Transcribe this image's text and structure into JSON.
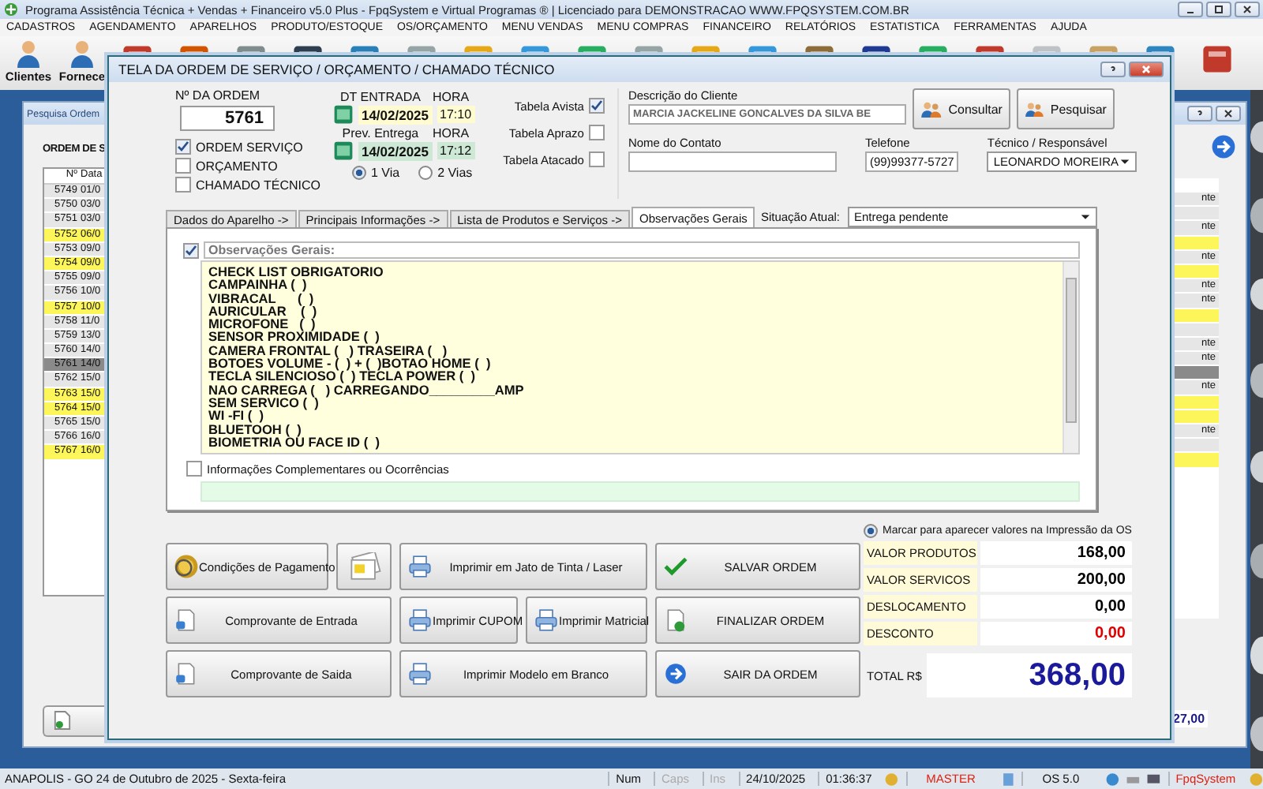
{
  "app": {
    "title": "Programa Assistência Técnica + Vendas + Financeiro v5.0 Plus - FpqSystem e Virtual Programas ® | Licenciado para  DEMONSTRACAO WWW.FPQSYSTEM.COM.BR"
  },
  "menu": [
    "CADASTROS",
    "AGENDAMENTO",
    "APARELHOS",
    "PRODUTO/ESTOQUE",
    "OS/ORÇAMENTO",
    "MENU VENDAS",
    "MENU COMPRAS",
    "FINANCEIRO",
    "RELATÓRIOS",
    "ESTATISTICA",
    "FERRAMENTAS",
    "AJUDA"
  ],
  "toolbar": {
    "labels": [
      "Clientes",
      "Fornece"
    ]
  },
  "search_window": {
    "title": "Pesquisa Ordem",
    "heading": "ORDEM DE S",
    "columns": [
      "Nº",
      "Data"
    ],
    "total": "27,00",
    "rows": [
      {
        "number": "5749",
        "date": "01/0",
        "color": "#e6e6e6",
        "tail": "nte"
      },
      {
        "number": "5750",
        "date": "03/0",
        "color": "#e6e6e6"
      },
      {
        "number": "5751",
        "date": "03/0",
        "color": "#e6e6e6",
        "tail": "nte"
      },
      {
        "number": "5752",
        "date": "06/0",
        "color": "#fdf65a"
      },
      {
        "number": "5753",
        "date": "09/0",
        "color": "#e6e6e6",
        "tail": "nte"
      },
      {
        "number": "5754",
        "date": "09/0",
        "color": "#fdf65a"
      },
      {
        "number": "5755",
        "date": "09/0",
        "color": "#e6e6e6",
        "tail": "nte"
      },
      {
        "number": "5756",
        "date": "10/0",
        "color": "#e6e6e6",
        "tail": "nte"
      },
      {
        "number": "5757",
        "date": "10/0",
        "color": "#fdf65a"
      },
      {
        "number": "5758",
        "date": "11/0",
        "color": "#e6e6e6"
      },
      {
        "number": "5759",
        "date": "13/0",
        "color": "#e6e6e6",
        "tail": "nte"
      },
      {
        "number": "5760",
        "date": "14/0",
        "color": "#e6e6e6",
        "tail": "nte"
      },
      {
        "number": "5761",
        "date": "14/0",
        "color": "#8a8a8a"
      },
      {
        "number": "5762",
        "date": "15/0",
        "color": "#e6e6e6",
        "tail": "nte"
      },
      {
        "number": "5763",
        "date": "15/0",
        "color": "#fdf65a"
      },
      {
        "number": "5764",
        "date": "15/0",
        "color": "#fdf65a"
      },
      {
        "number": "5765",
        "date": "15/0",
        "color": "#e6e6e6",
        "tail": "nte"
      },
      {
        "number": "5766",
        "date": "16/0",
        "color": "#e6e6e6"
      },
      {
        "number": "5767",
        "date": "16/0",
        "color": "#fdf65a"
      }
    ]
  },
  "dialog": {
    "title": "TELA DA ORDEM DE SERVIÇO / ORÇAMENTO / CHAMADO TÉCNICO",
    "order": {
      "label": "Nº DA ORDEM",
      "number": "5761",
      "types": [
        {
          "label": "ORDEM SERVIÇO",
          "checked": true
        },
        {
          "label": "ORÇAMENTO",
          "checked": false
        },
        {
          "label": "CHAMADO TÉCNICO",
          "checked": false
        }
      ]
    },
    "dates": {
      "entry_label": "DT ENTRADA",
      "entry_hour_label": "HORA",
      "entry_date": "14/02/2025",
      "entry_time": "17:10",
      "due_label": "Prev. Entrega",
      "due_hour_label": "HORA",
      "due_date": "14/02/2025",
      "due_time": "17:12",
      "copies": [
        {
          "label": "1 Via",
          "selected": true
        },
        {
          "label": "2 Vias",
          "selected": false
        }
      ]
    },
    "price_tables": [
      {
        "label": "Tabela Avista",
        "checked": true
      },
      {
        "label": "Tabela Aprazo",
        "checked": false
      },
      {
        "label": "Tabela Atacado",
        "checked": false
      }
    ],
    "client": {
      "label": "Descrição do Cliente",
      "value": "MARCIA JACKELINE GONCALVES DA SILVA BE",
      "contact_label": "Nome do Contato",
      "phone_label": "Telefone",
      "phone": "(99)99377-5727",
      "tech_label": "Técnico / Responsável",
      "tech": "LEONARDO MOREIRA",
      "buttons": [
        "Consultar",
        "Pesquisar"
      ]
    },
    "tabs": [
      {
        "label": "Dados do Aparelho ->",
        "selected": false
      },
      {
        "label": "Principais Informações ->",
        "selected": false
      },
      {
        "label": "Lista de Produtos e Serviços ->",
        "selected": false
      },
      {
        "label": "Observações Gerais",
        "selected": true
      }
    ],
    "status": {
      "label": "Situação Atual:",
      "value": "Entrega pendente"
    },
    "notes": {
      "label": "Observações Gerais:",
      "checked": true,
      "lines": [
        "CHECK LIST OBRIGATORIO",
        "CAMPAINHA (  )",
        "VIBRACAL      (  )",
        "AURICULAR    (  )",
        "MICROFONE   (  )",
        "SENSOR PROXIMIDADE (  )",
        "CAMERA FRONTAL (   ) TRASEIRA (   )",
        "BOTOES VOLUME - (  ) + (  )BOTAO HOME (  )",
        "TECLA SILENCIOSO (  ) TECLA POWER (  )",
        "NAO CARREGA (   ) CARREGANDO_________AMP",
        "SEM SERVICO (  )",
        "WI -FI (  )",
        "BLUETOOH (  )",
        "BIOMETRIA OU FACE ID (  )"
      ]
    },
    "extra": {
      "label": "Informações Complementares ou Ocorrências",
      "checked": false
    },
    "buttons": [
      "Condições de Pagamento",
      "Imprimir em Jato de Tinta / Laser",
      "SALVAR ORDEM",
      "Comprovante de Entrada",
      "Imprimir CUPOM",
      "Imprimir Matricial",
      "FINALIZAR ORDEM",
      "Comprovante de Saida",
      "Imprimir Modelo em Branco",
      "SAIR DA ORDEM"
    ],
    "totals": {
      "print_option": {
        "label": "Marcar para aparecer valores na Impressão da OS",
        "selected": true
      },
      "items": [
        {
          "label": "VALOR PRODUTOS",
          "value": "168,00",
          "color": "#000000"
        },
        {
          "label": "VALOR SERVICOS",
          "value": "200,00",
          "color": "#000000"
        },
        {
          "label": "DESLOCAMENTO",
          "value": "0,00",
          "color": "#000000"
        },
        {
          "label": "DESCONTO",
          "value": "0,00",
          "color": "#e00000"
        }
      ],
      "total_label": "TOTAL R$",
      "total": "368,00"
    }
  },
  "status_bar": {
    "location": "ANAPOLIS - GO 24 de Outubro de 2025 - Sexta-feira",
    "num": "Num",
    "caps": "Caps",
    "ins": "Ins",
    "date": "24/10/2025",
    "time": "01:36:37",
    "user": "MASTER",
    "version": "OS 5.0",
    "brand": "FpqSystem"
  }
}
